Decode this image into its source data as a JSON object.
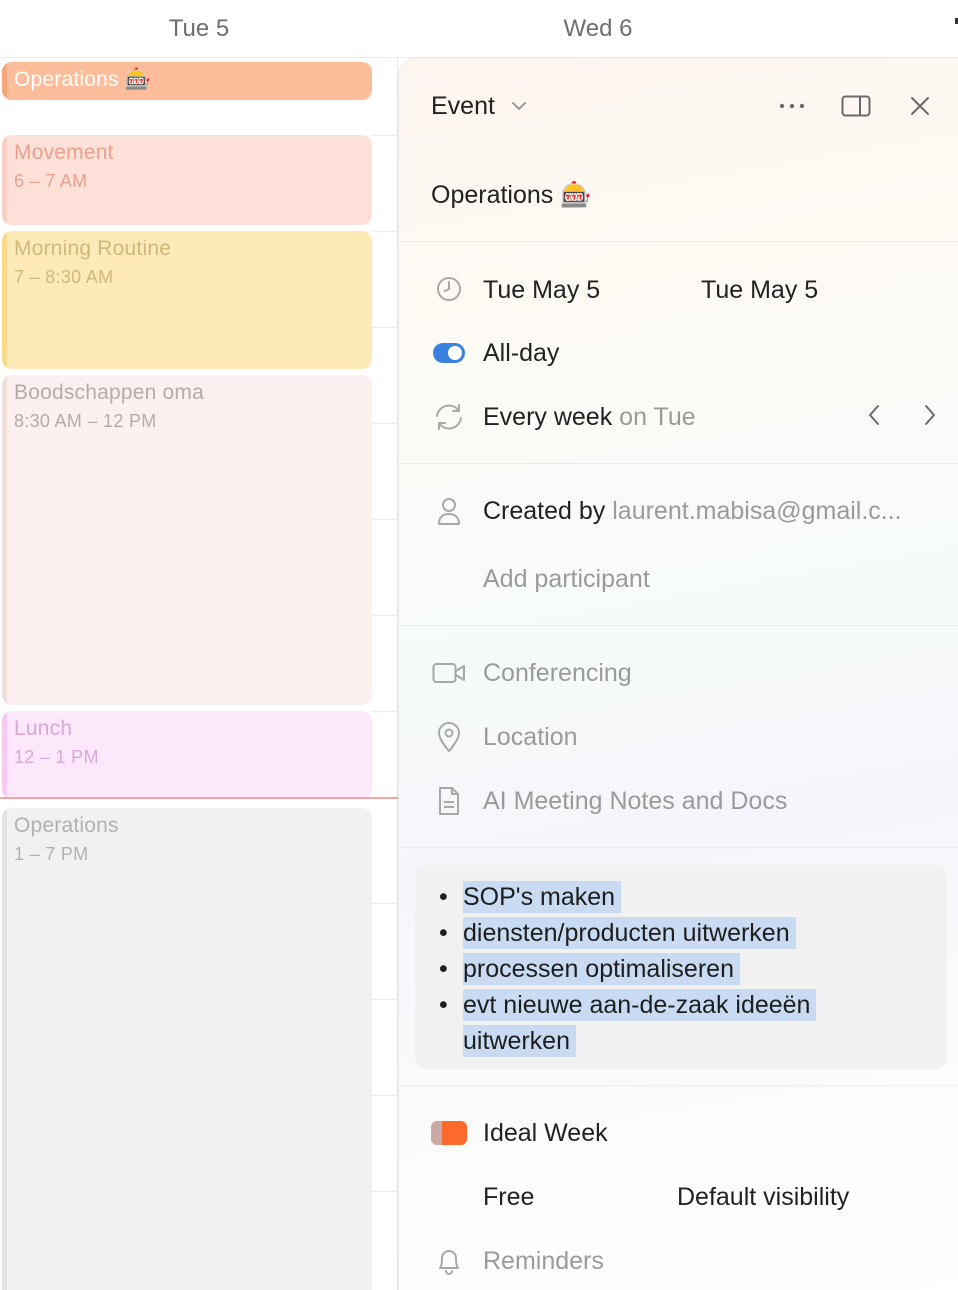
{
  "calendar": {
    "days": [
      {
        "label": "Tue 5"
      },
      {
        "label": "Wed 6"
      }
    ],
    "events": {
      "allday": {
        "title": "Operations 🎰"
      },
      "movement": {
        "title": "Movement",
        "time": "6 – 7 AM"
      },
      "morning": {
        "title": "Morning Routine",
        "time": "7 – 8:30 AM"
      },
      "bood": {
        "title": "Boodschappen oma",
        "time": "8:30 AM – 12 PM"
      },
      "lunch": {
        "title": "Lunch",
        "time": "12 – 1 PM"
      },
      "ops": {
        "title": "Operations",
        "time": "1 – 7 PM"
      }
    }
  },
  "panel": {
    "type_label": "Event",
    "title": "Operations 🎰",
    "start_date": "Tue May 5",
    "end_date": "Tue May 5",
    "allday_label": "All-day",
    "recurrence_prefix": "Every week",
    "recurrence_suffix": "on Tue",
    "created_by_label": "Created by",
    "created_by_email": "laurent.mabisa@gmail.c...",
    "add_participant": "Add participant",
    "conferencing": "Conferencing",
    "location": "Location",
    "ai_notes": "AI Meeting Notes and Docs",
    "notes": [
      "SOP's maken",
      "diensten/producten uitwerken",
      "processen optimaliseren",
      "evt nieuwe aan-de-zaak ideeën",
      "uitwerken"
    ],
    "calendar_name": "Ideal Week",
    "availability": "Free",
    "visibility": "Default visibility",
    "reminders": "Reminders"
  },
  "colors": {
    "toggle_on": "#3b82e0",
    "calendar_swatch": "#fb6a2c",
    "highlight": "#c9dbf2"
  }
}
